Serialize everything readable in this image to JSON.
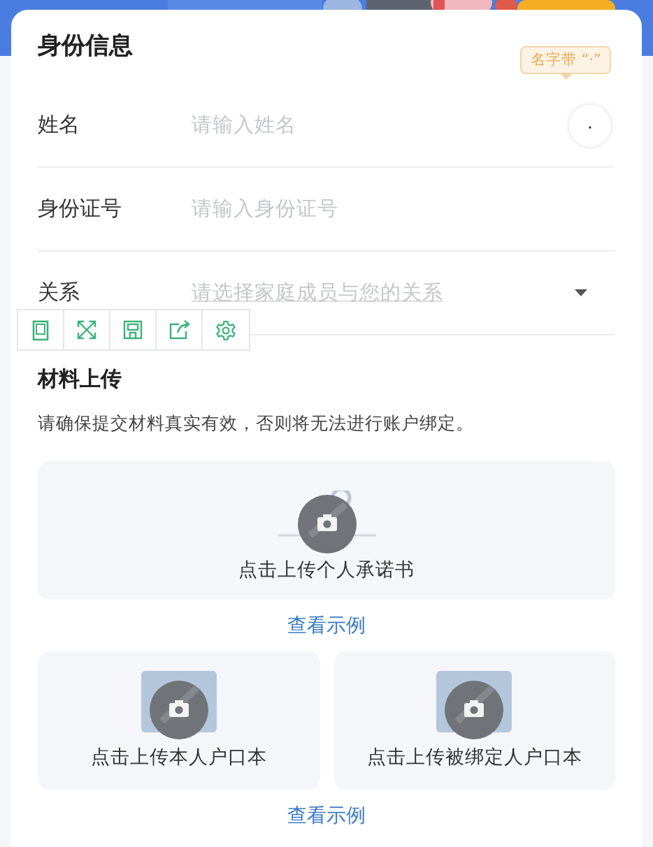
{
  "identity": {
    "title": "身份信息",
    "tooltip": "名字带 “·”",
    "dot_button": "·",
    "fields": [
      {
        "label": "姓名",
        "placeholder": "请输入姓名",
        "kind": "text"
      },
      {
        "label": "身份证号",
        "placeholder": "请输入身份证号",
        "kind": "text"
      },
      {
        "label": "关系",
        "placeholder": "请选择家庭成员与您的关系",
        "kind": "select"
      }
    ]
  },
  "materials": {
    "title": "材料上传",
    "note": "请确保提交材料真实有效，否则将无法进行账户绑定。",
    "groups": [
      {
        "uploads": [
          {
            "label": "点击上传个人承诺书",
            "kind": "wide"
          }
        ],
        "example_link": "查看示例"
      },
      {
        "uploads": [
          {
            "label": "点击上传本人户口本",
            "kind": "tile"
          },
          {
            "label": "点击上传被绑定人户口本",
            "kind": "tile"
          }
        ],
        "example_link": "查看示例"
      }
    ]
  }
}
